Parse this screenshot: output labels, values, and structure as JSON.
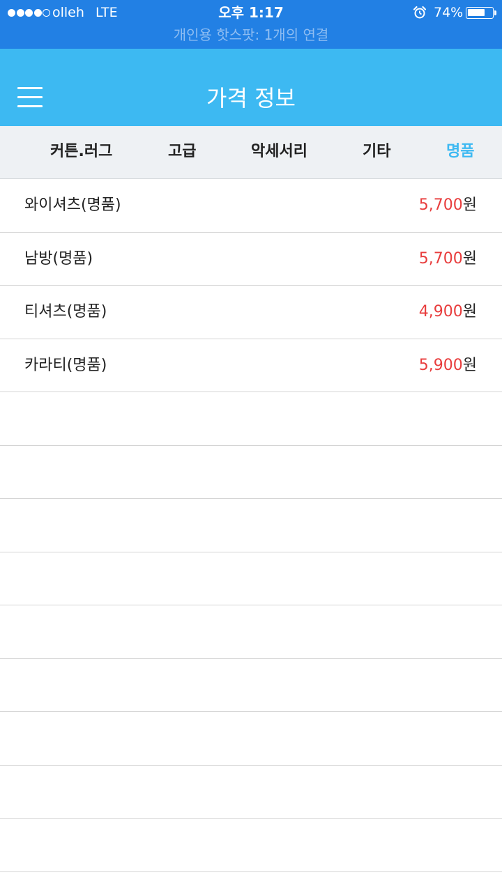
{
  "status_bar": {
    "signal_filled": 4,
    "signal_total": 5,
    "carrier": "olleh",
    "network": "LTE",
    "time": "오후 1:17",
    "battery_percent": "74%",
    "battery_level": 0.74,
    "hotspot_text": "개인용 핫스팟: 1개의 연결",
    "alarm_icon": "alarm-clock-icon"
  },
  "nav": {
    "title": "가격 정보",
    "menu_icon": "hamburger-menu-icon"
  },
  "tabs": [
    {
      "label": "커튼.러그",
      "active": false
    },
    {
      "label": "고급",
      "active": false
    },
    {
      "label": "악세서리",
      "active": false
    },
    {
      "label": "기타",
      "active": false
    },
    {
      "label": "명품",
      "active": true
    }
  ],
  "items": [
    {
      "name": "와이셔츠(명품)",
      "price": "5,700",
      "unit": "원"
    },
    {
      "name": "남방(명품)",
      "price": "5,700",
      "unit": "원"
    },
    {
      "name": "티셔츠(명품)",
      "price": "4,900",
      "unit": "원"
    },
    {
      "name": "카라티(명품)",
      "price": "5,900",
      "unit": "원"
    }
  ],
  "colors": {
    "status_bar": "#2280e4",
    "nav_bar": "#3db9f2",
    "active_tab": "#3db9f2",
    "price": "#e83d3d"
  }
}
